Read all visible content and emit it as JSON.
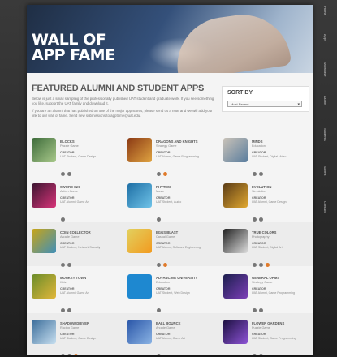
{
  "hero": {
    "title": "WALL OF\nAPP FAME"
  },
  "side_tabs": [
    "Home",
    "Apps",
    "Showcase",
    "Alumni",
    "Students",
    "Submit",
    "Contact"
  ],
  "section": {
    "heading": "FEATURED ALUMNI AND STUDENT APPS",
    "intro_1": "Below is just a small sampling of the professionally published UAT student and graduate work. If you see something you like, support the UAT family and download it.",
    "intro_2": "If you are an alumni that has published on one of the major app stores, please send us a note and we will add your link to our wall of fame. Send new submissions to appfame@uat.edu."
  },
  "sort": {
    "label": "SORT BY",
    "selected": "Most Recent"
  },
  "apps": [
    {
      "name": "BLOCKS",
      "sub": "Puzzle Game",
      "by": "CREATOR",
      "dev": "UAT Student, Game Design",
      "thumb": [
        "#3d6b3a",
        "#a9c98b"
      ],
      "badges": [
        "#777",
        "#777"
      ]
    },
    {
      "name": "DRAGONS AND KNIGHTS",
      "sub": "Strategy Game",
      "by": "CREATOR",
      "dev": "UAT Alumni, Game Programming",
      "thumb": [
        "#8b3a14",
        "#e0a441"
      ],
      "badges": [
        "#777",
        "#e07a2a"
      ]
    },
    {
      "name": "MINDS",
      "sub": "Education",
      "by": "CREATOR",
      "dev": "UAT Student, Digital Video",
      "thumb": [
        "#c9c2b8",
        "#5a7d9e"
      ],
      "badges": [
        "#777",
        "#777"
      ]
    },
    {
      "name": "SWORD INK",
      "sub": "Action Game",
      "by": "CREATOR",
      "dev": "UAT Alumni, Game Art",
      "thumb": [
        "#3b1530",
        "#d8347a"
      ],
      "badges": [
        "#777"
      ]
    },
    {
      "name": "RHYTHM",
      "sub": "Music",
      "by": "CREATOR",
      "dev": "UAT Student, Audio",
      "thumb": [
        "#1e6fa5",
        "#6fc3e8"
      ],
      "badges": [
        "#777"
      ]
    },
    {
      "name": "EVOLUTION",
      "sub": "Simulation",
      "by": "CREATOR",
      "dev": "UAT Alumni, Game Design",
      "thumb": [
        "#5b3c16",
        "#e1a830"
      ],
      "badges": [
        "#777",
        "#777"
      ]
    },
    {
      "name": "COIN COLLECTOR",
      "sub": "Arcade Game",
      "by": "CREATOR",
      "dev": "UAT Student, Network Security",
      "thumb": [
        "#c9a516",
        "#3f8fb9"
      ],
      "badges": [
        "#777",
        "#777"
      ]
    },
    {
      "name": "EGGS BLAST",
      "sub": "Casual Game",
      "by": "CREATOR",
      "dev": "UAT Alumni, Software Engineering",
      "thumb": [
        "#e2d05e",
        "#f29a1f"
      ],
      "badges": [
        "#777",
        "#e07a2a"
      ]
    },
    {
      "name": "TRUE COLORS",
      "sub": "Photography",
      "by": "CREATOR",
      "dev": "UAT Student, Digital Art",
      "thumb": [
        "#222222",
        "#dddddd"
      ],
      "badges": [
        "#777",
        "#777",
        "#e07a2a"
      ]
    },
    {
      "name": "MONKEY TOWN",
      "sub": "Kids",
      "by": "CREATOR",
      "dev": "UAT Alumni, Game Art",
      "thumb": [
        "#6a8c2a",
        "#e2b73a"
      ],
      "badges": [
        "#777",
        "#777"
      ]
    },
    {
      "name": "ADVANCING UNIVERSITY",
      "sub": "Education",
      "by": "CREATOR",
      "dev": "UAT Student, Web Design",
      "thumb": [
        "#1e88d0",
        "#1e88d0"
      ],
      "badges": [
        "#777"
      ]
    },
    {
      "name": "GENERAL OHMS",
      "sub": "Strategy Game",
      "by": "CREATOR",
      "dev": "UAT Alumni, Game Programming",
      "thumb": [
        "#1c1f4e",
        "#7c3fb8"
      ],
      "badges": [
        "#777",
        "#777"
      ]
    },
    {
      "name": "SHADOW DRIVER",
      "sub": "Racing Game",
      "by": "CREATOR",
      "dev": "UAT Student, Game Design",
      "thumb": [
        "#3b6d9a",
        "#c7dff0"
      ],
      "badges": [
        "#777",
        "#777",
        "#e07a2a"
      ]
    },
    {
      "name": "BALL BOUNCE",
      "sub": "Arcade Game",
      "by": "CREATOR",
      "dev": "UAT Alumni, Game Art",
      "thumb": [
        "#2a56a8",
        "#8ab3e4"
      ],
      "badges": [
        "#777"
      ]
    },
    {
      "name": "FLOWER GARDENS",
      "sub": "Puzzle Game",
      "by": "CREATOR",
      "dev": "UAT Student, Game Programming",
      "thumb": [
        "#1c1040",
        "#8e54d6"
      ],
      "badges": [
        "#777",
        "#777"
      ]
    }
  ]
}
